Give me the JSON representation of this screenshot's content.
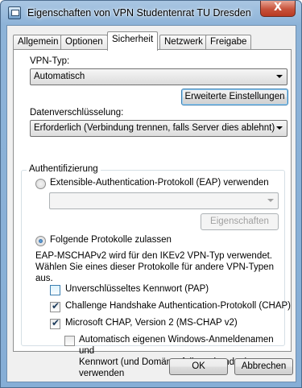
{
  "window": {
    "title": "Eigenschaften von VPN Studentenrat TU Dresden",
    "close_label": "X"
  },
  "tabs": [
    {
      "label": "Allgemein"
    },
    {
      "label": "Optionen"
    },
    {
      "label": "Sicherheit",
      "active": true
    },
    {
      "label": "Netzwerk"
    },
    {
      "label": "Freigabe"
    }
  ],
  "security": {
    "vpn_type_label": "VPN-Typ:",
    "vpn_type_value": "Automatisch",
    "advanced_button": "Erweiterte Einstellungen",
    "encryption_label": "Datenverschlüsselung:",
    "encryption_value": "Erforderlich (Verbindung trennen, falls Server dies ablehnt)"
  },
  "auth": {
    "legend": "Authentifizierung",
    "eap_radio_label": "Extensible-Authentication-Protokoll (EAP) verwenden",
    "eap_selected": false,
    "eap_combo_value": "",
    "properties_button": "Eigenschaften",
    "protocols_radio_label": "Folgende Protokolle zulassen",
    "protocols_selected": true,
    "info_text": "EAP-MSCHAPv2 wird für den IKEv2 VPN-Typ verwendet.\nWählen Sie eines dieser Protokolle für andere VPN-Typen\naus.",
    "protocols": [
      {
        "label": "Unverschlüsseltes Kennwort (PAP)",
        "checked": false
      },
      {
        "label": "Challenge Handshake Authentication-Protokoll (CHAP)",
        "checked": true
      },
      {
        "label": "Microsoft CHAP, Version 2 (MS-CHAP v2)",
        "checked": true
      }
    ],
    "auto_windows_login_label": "Automatisch eigenen Windows-Anmeldenamen und\nKennwort (und Domäne, falls vorhanden) verwenden",
    "auto_windows_login_checked": false
  },
  "footer": {
    "ok_button": "OK",
    "cancel_button": "Abbrechen"
  },
  "glyphs": {
    "check": "✔"
  },
  "colors": {
    "title_bar": "#8db3d8",
    "close_button": "#c7523b",
    "dialog_background": "#f0f0f0"
  }
}
